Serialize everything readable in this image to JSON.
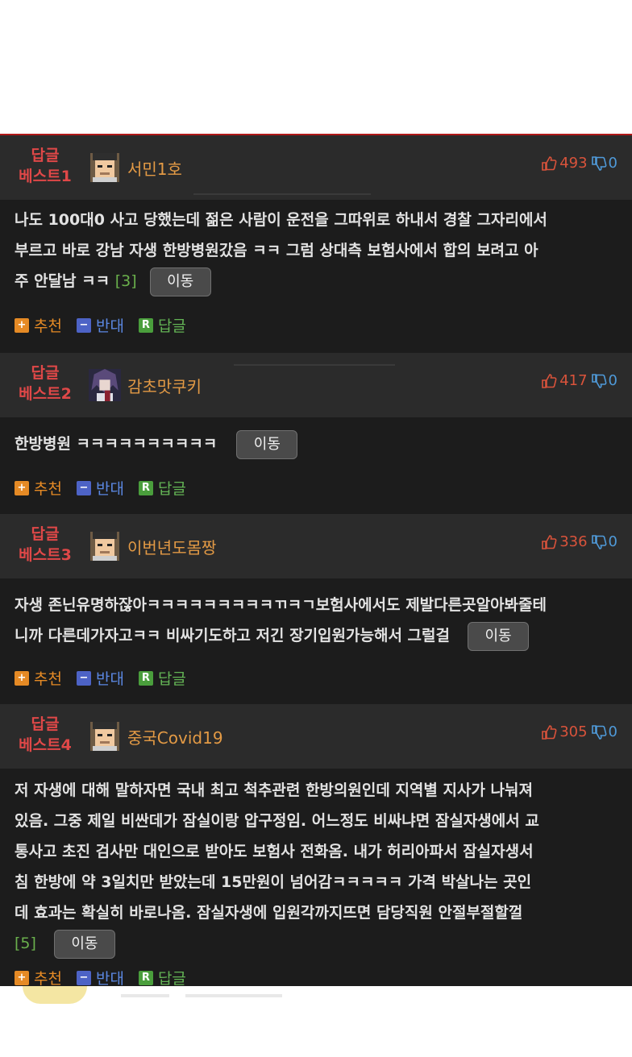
{
  "colors": {
    "badge": "#e04848",
    "nick": "#e39a45",
    "up": "#d9533b",
    "down": "#4f9ad9",
    "accent_border": "#b01818"
  },
  "buttons": {
    "move_label": "이동"
  },
  "actions": {
    "recommend": "추천",
    "oppose": "반대",
    "reply": "답글",
    "recommend_icon": "+",
    "oppose_icon": "−",
    "reply_icon": "R"
  },
  "comments": [
    {
      "badge_line1": "답글",
      "badge_line2": "베스트1",
      "nickname": "서민1호",
      "avatar": "pixel-man-avatar",
      "upvotes": "493",
      "downvotes": "0",
      "lines": [
        "나도 100대0 사고 당했는데 젊은 사람이 운전을 그따위로 하내서 경찰 그자리에서",
        "부르고 바로 강남 자생 한방병원갔음 ㅋㅋ 그럼 상대측 보험사에서 합의 보려고 아",
        "주 안달남 ㅋㅋ"
      ],
      "reply_count": "[3]"
    },
    {
      "badge_line1": "답글",
      "badge_line2": "베스트2",
      "nickname": "감초맛쿠키",
      "avatar": "anime-avatar",
      "upvotes": "417",
      "downvotes": "0",
      "lines": [
        "한방병원 ㅋㅋㅋㅋㅋㅋㅋㅋㅋㅋ"
      ],
      "reply_count": ""
    },
    {
      "badge_line1": "답글",
      "badge_line2": "베스트3",
      "nickname": "이번년도몸짱",
      "avatar": "pixel-man-avatar",
      "upvotes": "336",
      "downvotes": "0",
      "lines": [
        "자생 존닌유명하잖아ㅋㅋㅋㅋㅋㅋㅋㅋㅋㄲㅋㄱ보험사에서도 제발다른곳알아봐줄테",
        "니까 다른데가자고ㅋㅋ 비싸기도하고 저긴 장기입원가능해서 그럴걸"
      ],
      "reply_count": ""
    },
    {
      "badge_line1": "답글",
      "badge_line2": "베스트4",
      "nickname": "중국Covid19",
      "avatar": "pixel-man-avatar",
      "upvotes": "305",
      "downvotes": "0",
      "lines": [
        "저 자생에 대해 말하자면 국내 최고 척추관련 한방의원인데 지역별 지사가 나눠져",
        "있음. 그중 제일 비싼데가 잠실이랑 압구정임. 어느정도 비싸냐면 잠실자생에서 교",
        "통사고 초진 검사만 대인으로 받아도 보험사 전화옴. 내가 허리아파서 잠실자생서",
        "침 한방에 약 3일치만 받았는데 15만원이 넘어감ㅋㅋㅋㅋㅋ 가격 박살나는 곳인",
        "데 효과는 확실히 바로나옴. 잠실자생에 입원각까지뜨면 담당직원 안절부절할껄"
      ],
      "reply_count": "[5]"
    }
  ]
}
